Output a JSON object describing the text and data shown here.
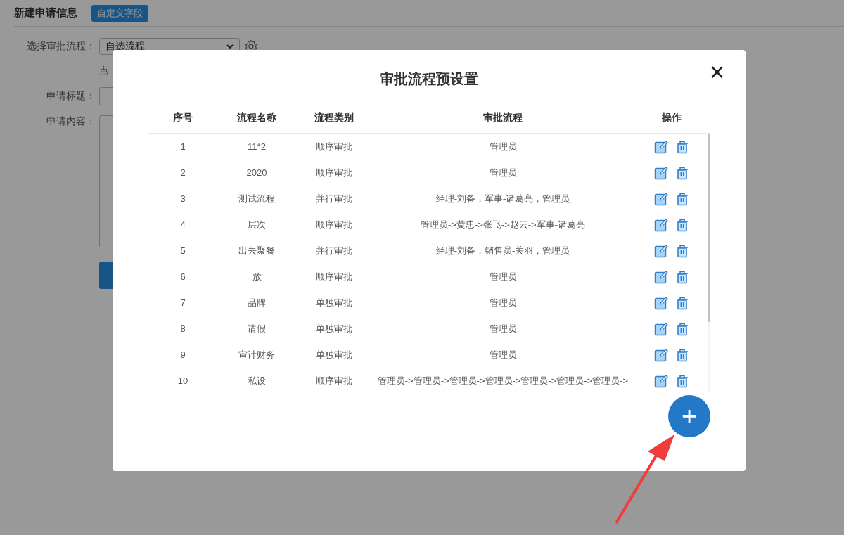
{
  "page": {
    "title": "新建申请信息",
    "custom_field_button": "自定义字段",
    "form": {
      "flow_label": "选择审批流程：",
      "flow_value": "自选流程",
      "link_text": "点",
      "title_label": "申请标题：",
      "content_label": "申请内容："
    }
  },
  "dialog": {
    "title": "审批流程预设置",
    "close": "×",
    "table": {
      "columns": [
        "序号",
        "流程名称",
        "流程类别",
        "审批流程",
        "操作"
      ],
      "rows": [
        {
          "no": "1",
          "name": "11*2",
          "type": "顺序审批",
          "flow": "管理员"
        },
        {
          "no": "2",
          "name": "2020",
          "type": "顺序审批",
          "flow": "管理员"
        },
        {
          "no": "3",
          "name": "测试流程",
          "type": "并行审批",
          "flow": "经理-刘备，军事-诸葛亮，管理员"
        },
        {
          "no": "4",
          "name": "层次",
          "type": "顺序审批",
          "flow": "管理员->黄忠->张飞->赵云->军事-诸葛亮"
        },
        {
          "no": "5",
          "name": "出去聚餐",
          "type": "并行审批",
          "flow": "经理-刘备，销售员-关羽，管理员"
        },
        {
          "no": "6",
          "name": "放",
          "type": "顺序审批",
          "flow": "管理员"
        },
        {
          "no": "7",
          "name": "品牌",
          "type": "单独审批",
          "flow": "管理员"
        },
        {
          "no": "8",
          "name": "请假",
          "type": "单独审批",
          "flow": "管理员"
        },
        {
          "no": "9",
          "name": "审计财务",
          "type": "单独审批",
          "flow": "管理员"
        },
        {
          "no": "10",
          "name": "私设",
          "type": "顺序审批",
          "flow": "管理员->管理员->管理员->管理员->管理员->管理员->管理员->"
        }
      ]
    },
    "add_button": "+"
  }
}
